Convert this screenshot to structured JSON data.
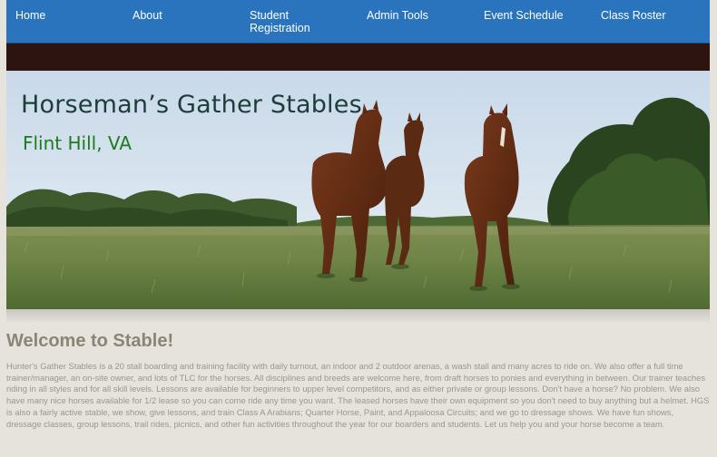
{
  "nav": {
    "items": [
      {
        "label": "Home"
      },
      {
        "label": "About"
      },
      {
        "label": "Student Registration"
      },
      {
        "label": "Admin Tools"
      },
      {
        "label": "Event Schedule"
      },
      {
        "label": "Class Roster"
      }
    ]
  },
  "hero": {
    "title": "Horseman’s Gather Stables",
    "subtitle": "Flint Hill, VA",
    "image": "three-horses-in-pasture"
  },
  "main": {
    "heading": "Welcome to Stable!",
    "body": "Hunter's Gather Stables is a 20 stall boarding and training facility with daily turnout, an indoor and 2 outdoor arenas, a wash stall and many acres to ride on. We also offer a full time trainer/manager, an on-site owner, and lots of TLC for the horses. All disciplines and breeds are welcome here, from draft horses to ponies and everything in between. Our trainer teaches riding in all styles and for all skill levels. Lessons are available for beginners to upper level competitors, and as either private or group lessons. Don't have a horse? No problem. We also have many nice horses available for 1/2 lease so you can come ride any time you want. The leased horses have their own equipment so you don't need to buy anything but a helmet. HGS is also a fairly active stable, we show, give lessons, and train Class A Arabians; Quarter Horse, Paint, and Appaloosa Circuits; and we go to dressage shows. We have fun shows, dressage classes, group lessons, trail rides, picnics, and other fun activities throughout the year for our boarders and students. Let us help you and your horse become a team."
  },
  "colors": {
    "nav_bg": "#2a74bd",
    "strip_bg": "#2e1410",
    "page_bg": "#e6e2dc",
    "heading": "#8a8575",
    "body_text": "#9b978c",
    "hero_title": "#1d3d3a",
    "hero_subtitle": "#1e7a1e"
  }
}
